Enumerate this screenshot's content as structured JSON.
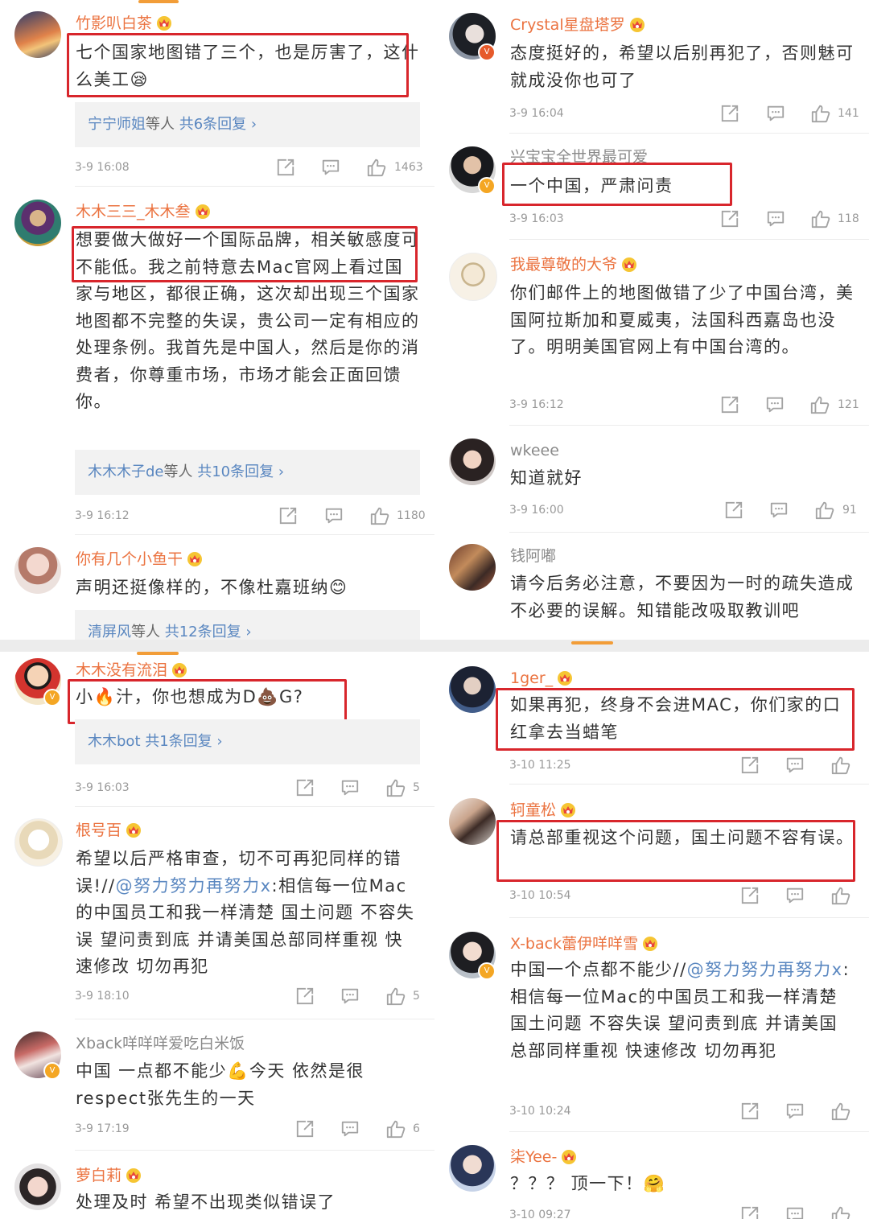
{
  "tl": {
    "c1": {
      "name": "竹影叭白茶",
      "text": "七个国家地图错了三个，也是厉害了，这什么美工😪",
      "replies_users": "宁宁师姐",
      "replies_suffix": "等人",
      "replies_count": "共6条回复 ›",
      "time": "3-9 16:08",
      "likes": "1463"
    },
    "c2": {
      "name": "木木三三_木木叁",
      "text": "想要做大做好一个国际品牌，相关敏感度可不能低。我之前特意去Mac官网上看过国家与地区，都很正确，这次却出现三个国家地图都不完整的失误，贵公司一定有相应的处理条例。我首先是中国人，然后是你的消费者，你尊重市场，市场才能会正面回馈你。",
      "replies_users": "木木木子de",
      "replies_suffix": "等人",
      "replies_count": "共10条回复 ›",
      "time": "3-9 16:12",
      "likes": "1180"
    },
    "c3": {
      "name": "你有几个小鱼干",
      "text": "声明还挺像样的，不像杜嘉班纳😊",
      "replies_users": "清屏风",
      "replies_suffix": "等人",
      "replies_count": "共12条回复 ›"
    }
  },
  "tr": {
    "c1": {
      "name": "Crystal星盘塔罗",
      "text": "态度挺好的，希望以后别再犯了，否则魅可就成没你也可了",
      "time": "3-9 16:04",
      "likes": "141"
    },
    "c2": {
      "name": "兴宝宝全世界最可爱",
      "text": "一个中国，严肃问责",
      "time": "3-9 16:03",
      "likes": "118"
    },
    "c3": {
      "name": "我最尊敬的大爷",
      "text": "你们邮件上的地图做错了少了中国台湾，美国阿拉斯加和夏威夷，法国科西嘉岛也没了。明明美国官网上有中国台湾的。",
      "time": "3-9 16:12",
      "likes": "121"
    },
    "c4": {
      "name": "wkeee",
      "text": "知道就好",
      "time": "3-9 16:00",
      "likes": "91"
    },
    "c5": {
      "name": "钱阿嘟",
      "text": "请今后务必注意，不要因为一时的疏失造成不必要的误解。知错能改吸取教训吧"
    }
  },
  "bl": {
    "c1": {
      "name": "木木没有流泪",
      "text": "小🔥汁，你也想成为D💩G?",
      "replies_users": "木木bot",
      "replies_count": "共1条回复 ›",
      "time": "3-9 16:03",
      "likes": "5"
    },
    "c2": {
      "name": "根号百",
      "text_a": "希望以后严格审查，切不可再犯同样的错误!//",
      "mention": "@努力努力再努力x",
      "text_b": ":相信每一位Mac的中国员工和我一样清楚 国土问题 不容失误 望问责到底 并请美国总部同样重视 快速修改 切勿再犯",
      "time": "3-9 18:10",
      "likes": "5"
    },
    "c3": {
      "name": "Xback咩咩咩爱吃白米饭",
      "text": "中国 一点都不能少💪今天 依然是很respect张先生的一天",
      "time": "3-9 17:19",
      "likes": "6"
    },
    "c4": {
      "name": "萝白莉",
      "text": "处理及时 希望不出现类似错误了"
    }
  },
  "br": {
    "c1": {
      "name": "1ger_",
      "text": "如果再犯，终身不会进MAC，你们家的口红拿去当蜡笔",
      "time": "3-10 11:25"
    },
    "c2": {
      "name": "轲童松",
      "text": "请总部重视这个问题，国土问题不容有误。",
      "time": "3-10 10:54"
    },
    "c3": {
      "name": "X-back蕾伊咩咩雪",
      "text_a": "中国一个点都不能少//",
      "mention": "@努力努力再努力x",
      "text_b": ":相信每一位Mac的中国员工和我一样清楚 国土问题 不容失误 望问责到底 并请美国总部同样重视 快速修改 切勿再犯",
      "time": "3-10 10:24"
    },
    "c4": {
      "name": "柒Yee-",
      "text": "？？？ 顶一下！🤗",
      "time": "3-10 09:27"
    }
  },
  "colors": {
    "name": "#eb7340",
    "link": "#5a87c0",
    "highlight": "#d8262c",
    "tab": "#f29d38"
  }
}
